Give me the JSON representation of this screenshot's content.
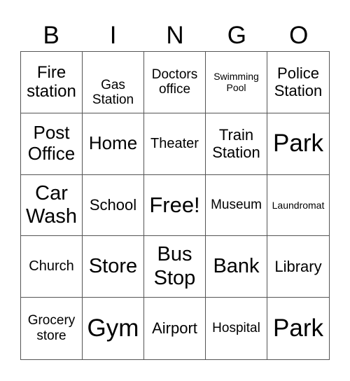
{
  "title_letters": [
    "B",
    "I",
    "N",
    "G",
    "O"
  ],
  "cells": [
    "Fire station",
    "Gas Station",
    "Doctors office",
    "Swimming Pool",
    "Police Station",
    "Post Office",
    "Home",
    "Theater",
    "Train Station",
    "Park",
    "Car Wash",
    "School",
    "Free!",
    "Museum",
    "Laundromat",
    "Church",
    "Store",
    "Bus Stop",
    "Bank",
    "Library",
    "Grocery store",
    "Gym",
    "Airport",
    "Hospital",
    "Park"
  ]
}
